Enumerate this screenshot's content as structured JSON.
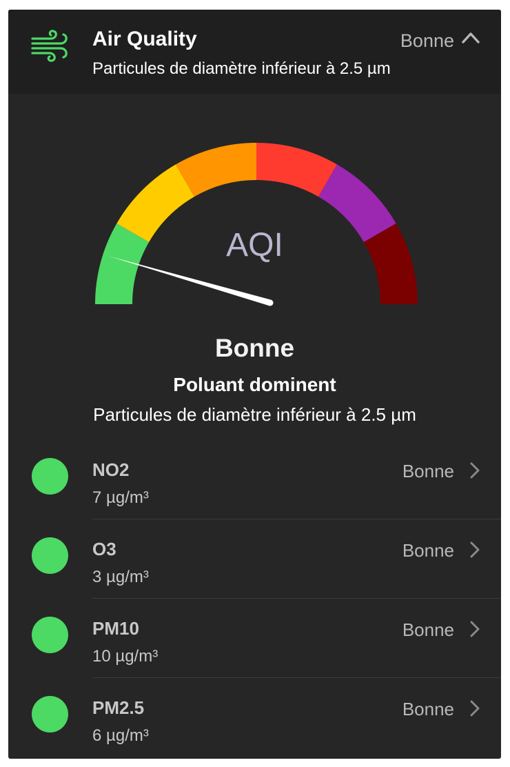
{
  "header": {
    "icon": "wind-icon",
    "title": "Air Quality",
    "subtitle": "Particules de diamètre inférieur à 2.5 µm",
    "status": "Bonne",
    "expand_icon": "chevron-up-icon"
  },
  "gauge": {
    "label": "AQI",
    "segment_colors": [
      "#4cd964",
      "#ffcc00",
      "#ff9500",
      "#ff3b30",
      "#9c27b0",
      "#7b0000"
    ],
    "needle_fraction": 0.1,
    "category": "Bonne"
  },
  "dominant": {
    "label": "Poluant dominent",
    "value": "Particules de diamètre inférieur à 2.5 µm"
  },
  "pollutants": [
    {
      "name": "NO2",
      "value": "7 µg/m³",
      "status": "Bonne",
      "color": "#4cd964"
    },
    {
      "name": "O3",
      "value": "3 µg/m³",
      "status": "Bonne",
      "color": "#4cd964"
    },
    {
      "name": "PM10",
      "value": "10 µg/m³",
      "status": "Bonne",
      "color": "#4cd964"
    },
    {
      "name": "PM2.5",
      "value": "6 µg/m³",
      "status": "Bonne",
      "color": "#4cd964"
    }
  ],
  "colors": {
    "accent": "#4cd964",
    "card_background": "#262626",
    "header_background": "#1f1f1f"
  }
}
